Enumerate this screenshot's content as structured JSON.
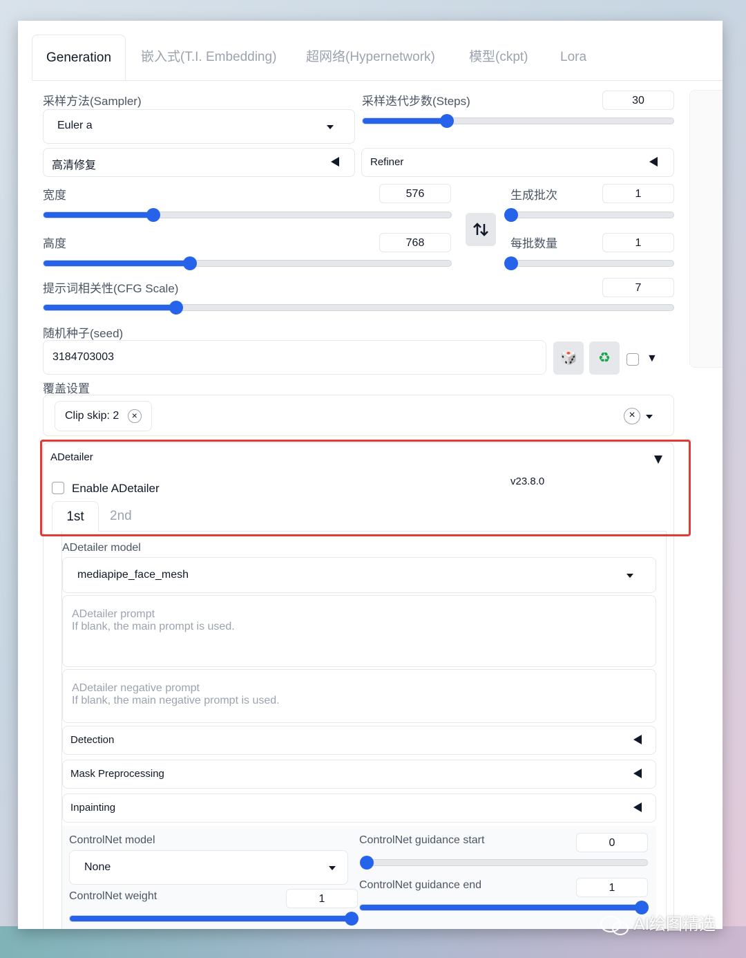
{
  "tabs": [
    {
      "label": "Generation",
      "active": true
    },
    {
      "label": "嵌入式(T.I. Embedding)"
    },
    {
      "label": "超网络(Hypernetwork)"
    },
    {
      "label": "模型(ckpt)"
    },
    {
      "label": "Lora"
    }
  ],
  "sampler": {
    "label": "采样方法(Sampler)",
    "value": "Euler a"
  },
  "steps": {
    "label": "采样迭代步数(Steps)",
    "value": "30",
    "fraction": 0.27
  },
  "hires": {
    "label": "高清修复"
  },
  "refiner": {
    "label": "Refiner"
  },
  "width": {
    "label": "宽度",
    "value": "576",
    "fraction": 0.27
  },
  "height": {
    "label": "高度",
    "value": "768",
    "fraction": 0.36
  },
  "swap_icon": "swap-icon",
  "batch_count": {
    "label": "生成批次",
    "value": "1",
    "fraction": 0.0
  },
  "batch_size": {
    "label": "每批数量",
    "value": "1",
    "fraction": 0.0
  },
  "cfg": {
    "label": "提示词相关性(CFG Scale)",
    "value": "7",
    "fraction": 0.21
  },
  "seed": {
    "label": "随机种子(seed)",
    "value": "3184703003",
    "dice_icon": "🎲",
    "recycle_icon": "♻",
    "extra_arrow": "▼"
  },
  "override": {
    "label": "覆盖设置",
    "chip": "Clip skip: 2",
    "chip_close": "×",
    "clear": "×"
  },
  "adetailer": {
    "title": "ADetailer",
    "enable_label": "Enable ADetailer",
    "version": "v23.8.0",
    "tabs": [
      "1st",
      "2nd"
    ],
    "model_label": "ADetailer model",
    "model_value": "mediapipe_face_mesh",
    "prompt_placeholder": "ADetailer prompt\nIf blank, the main prompt is used.",
    "neg_prompt_placeholder": "ADetailer negative prompt\nIf blank, the main negative prompt is used.",
    "sections": [
      "Detection",
      "Mask Preprocessing",
      "Inpainting"
    ],
    "controlnet_model_label": "ControlNet model",
    "controlnet_model_value": "None",
    "controlnet_weight_label": "ControlNet weight",
    "controlnet_weight_value": "1",
    "controlnet_weight_fraction": 1.0,
    "guidance_start_label": "ControlNet guidance start",
    "guidance_start_value": "0",
    "guidance_start_fraction": 0.0,
    "guidance_end_label": "ControlNet guidance end",
    "guidance_end_value": "1",
    "guidance_end_fraction": 1.0
  },
  "watermark": "AI绘图精选",
  "colors": {
    "accent": "#2563eb",
    "highlight": "#e53935"
  }
}
